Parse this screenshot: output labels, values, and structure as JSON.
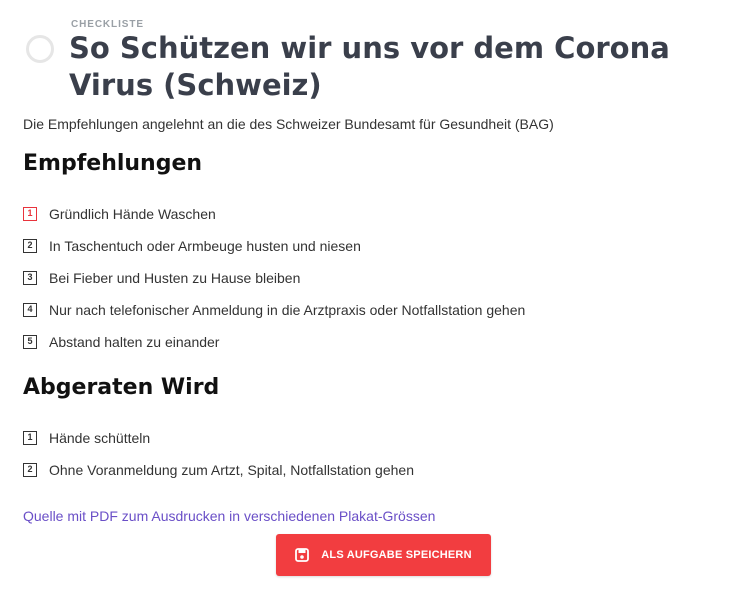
{
  "header": {
    "eyebrow": "CHECKLISTE",
    "title": "So Schützen wir uns vor dem Corona Virus (Schweiz)",
    "subtitle": "Die Empfehlungen angelehnt an die des Schweizer Bundesamt für Gesundheit (BAG)"
  },
  "sections": [
    {
      "heading": "Empfehlungen",
      "items": [
        {
          "num": "1",
          "label": "Gründlich Hände Waschen",
          "active": true
        },
        {
          "num": "2",
          "label": "In Taschentuch oder Armbeuge husten und niesen"
        },
        {
          "num": "3",
          "label": "Bei Fieber und Husten zu Hause bleiben"
        },
        {
          "num": "4",
          "label": "Nur nach telefonischer Anmeldung in die Arztpraxis oder Notfallstation gehen"
        },
        {
          "num": "5",
          "label": "Abstand halten zu einander"
        }
      ]
    },
    {
      "heading": "Abgeraten Wird",
      "items": [
        {
          "num": "1",
          "label": "Hände schütteln"
        },
        {
          "num": "2",
          "label": "Ohne Voranmeldung zum Artzt, Spital, Notfallstation gehen"
        }
      ]
    }
  ],
  "source_link": "Quelle mit PDF zum Ausdrucken in verschiedenen Plakat-Grössen",
  "save_button": {
    "label": "ALS AUFGABE SPEICHERN",
    "icon": "save-icon"
  },
  "colors": {
    "accent": "#f23d40",
    "link": "#6a4fc7",
    "title": "#3a3f4b"
  }
}
